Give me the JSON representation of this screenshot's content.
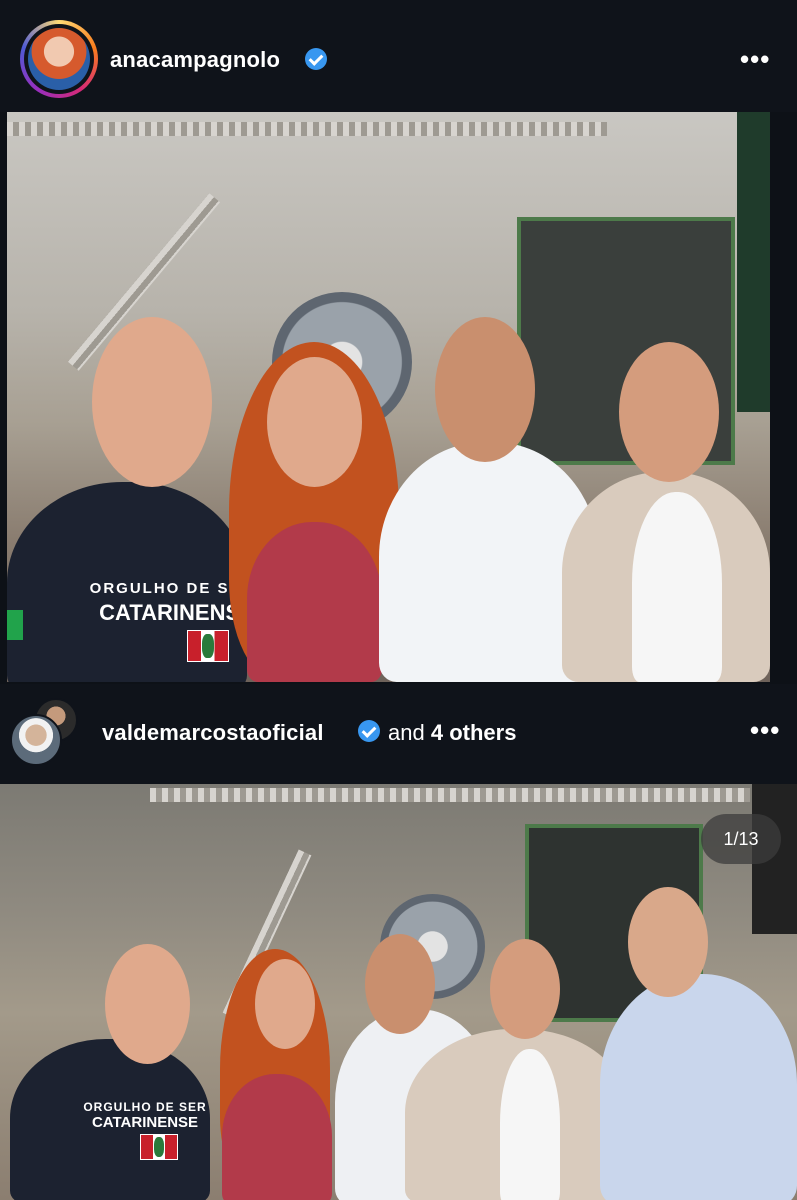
{
  "post1": {
    "username": "anacampagnolo",
    "more_label": "•••"
  },
  "post2": {
    "username": "valdemarcostaoficial",
    "and_label": "and",
    "others_label": "4 others",
    "more_label": "•••",
    "counter": "1/13"
  },
  "shirt": {
    "line1": "ORGULHO DE SER",
    "line2": "CATARINENSE"
  },
  "colors": {
    "verified": "#3897f0",
    "background": "#0f131a"
  }
}
